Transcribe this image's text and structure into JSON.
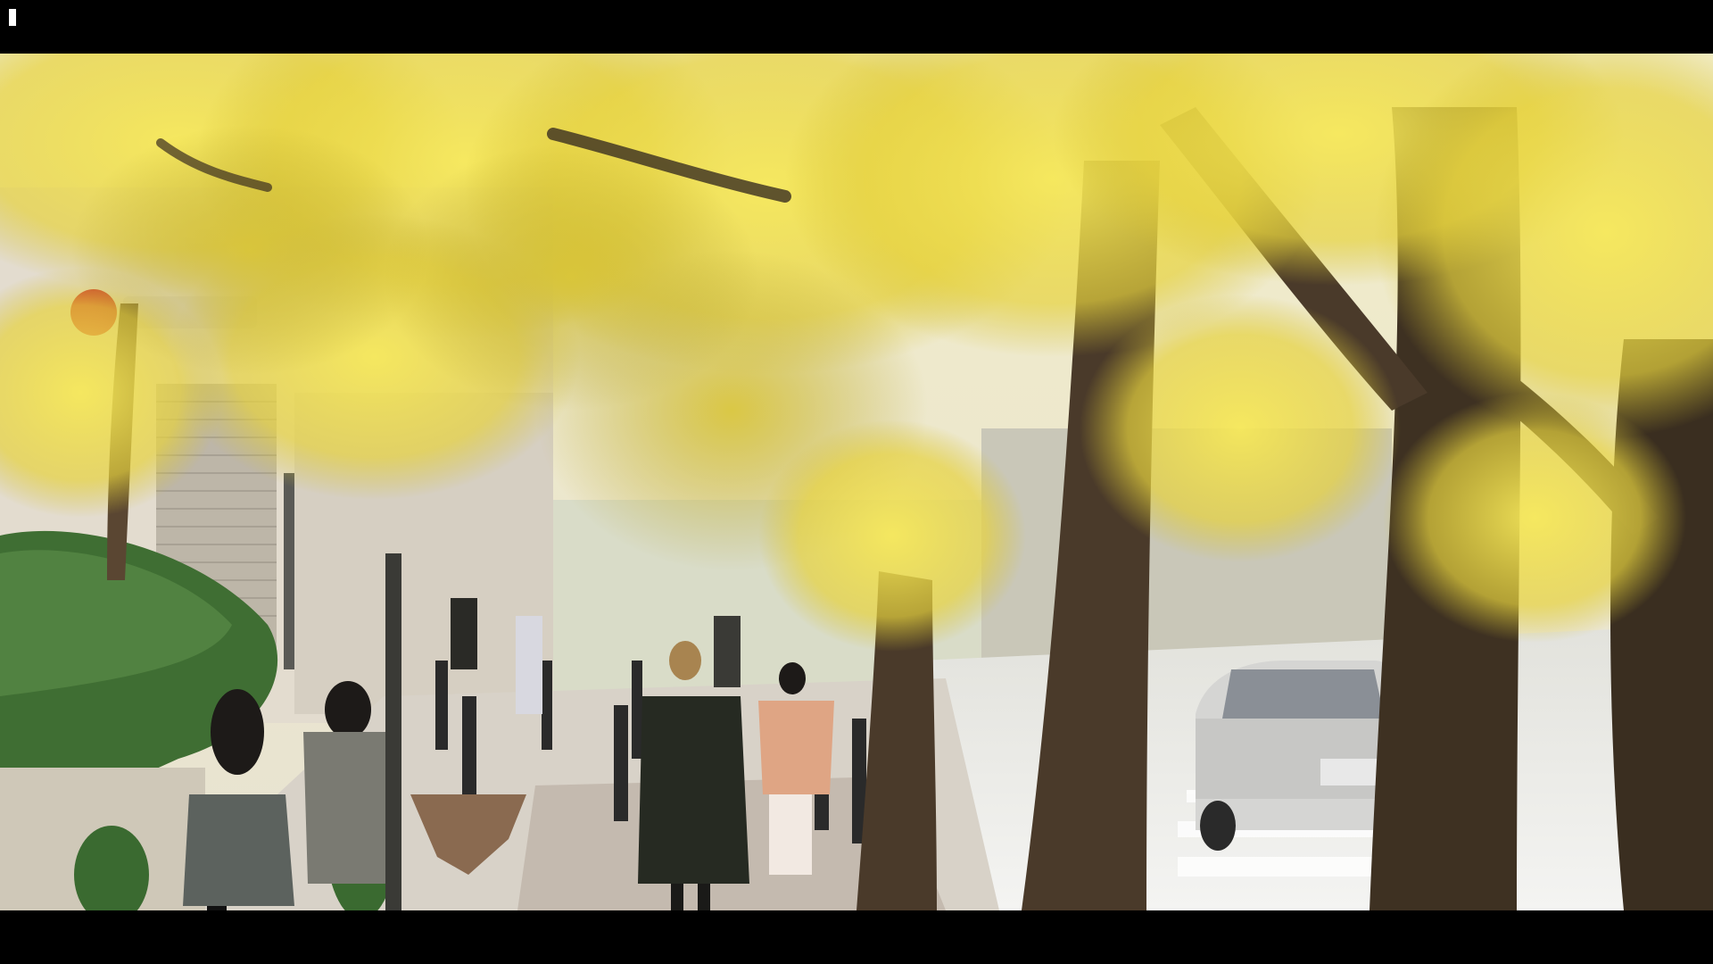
{
  "window": {
    "title": ""
  },
  "scene": {
    "description_icon": "film-frame",
    "colors": {
      "letterbox": "#000000",
      "foliage_bright": "#f2e14a",
      "foliage_mid": "#d9c63a",
      "foliage_shadow": "#a99a2a",
      "trunk": "#4a3a2a",
      "trunk_dark": "#2e241a",
      "building": "#e4ddd0",
      "hedge": "#3f6e33",
      "road": "#ececec",
      "car": "#d4d4d4",
      "sign_red": "#c8232c"
    }
  }
}
